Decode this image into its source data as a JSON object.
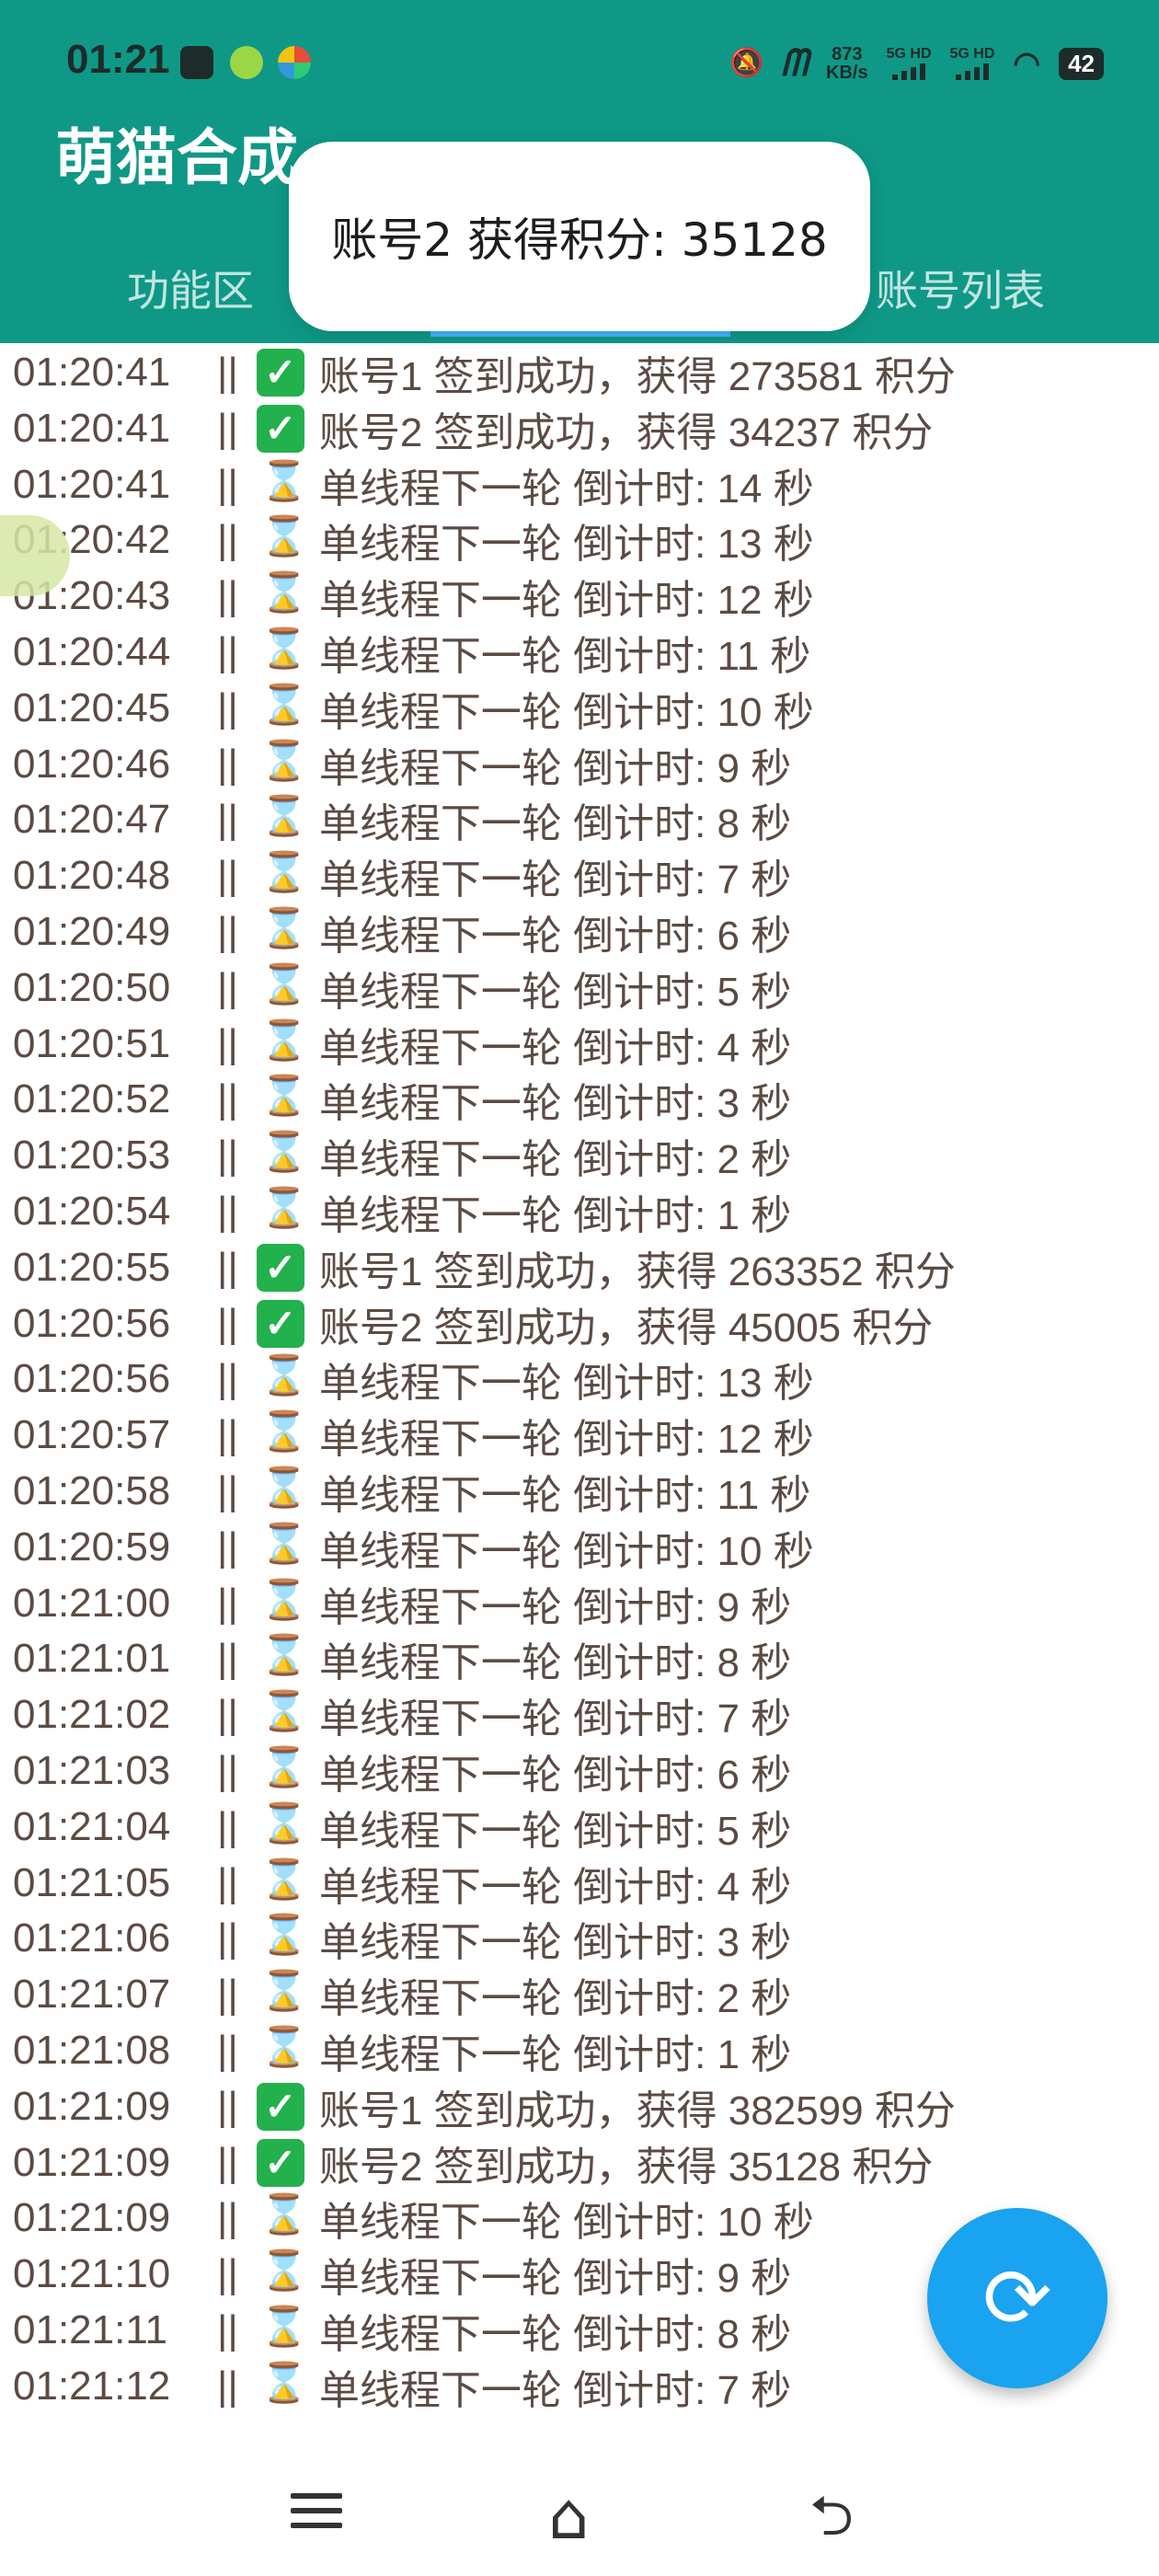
{
  "status_bar": {
    "time": "01:21",
    "speed_value": "873",
    "speed_unit": "KB/s",
    "sim1": "5G HD",
    "sim2": "5G HD",
    "battery": "42"
  },
  "header": {
    "app_title": "萌猫合成",
    "tab_function": "功能区",
    "tab_accounts": "账号列表"
  },
  "toast": {
    "text": "账号2 获得积分: 35128"
  },
  "log": {
    "separator": "||",
    "rows": [
      {
        "time": "01:20:41",
        "icon": "check",
        "text": "账号1 签到成功，获得 273581 积分"
      },
      {
        "time": "01:20:41",
        "icon": "check",
        "text": "账号2 签到成功，获得 34237 积分"
      },
      {
        "time": "01:20:41",
        "icon": "hourglass",
        "text": "单线程下一轮 倒计时: 14 秒"
      },
      {
        "time": "01:20:42",
        "icon": "hourglass",
        "text": "单线程下一轮 倒计时: 13 秒"
      },
      {
        "time": "01:20:43",
        "icon": "hourglass",
        "text": "单线程下一轮 倒计时: 12 秒"
      },
      {
        "time": "01:20:44",
        "icon": "hourglass",
        "text": "单线程下一轮 倒计时: 11 秒"
      },
      {
        "time": "01:20:45",
        "icon": "hourglass",
        "text": "单线程下一轮 倒计时: 10 秒"
      },
      {
        "time": "01:20:46",
        "icon": "hourglass",
        "text": "单线程下一轮 倒计时: 9 秒"
      },
      {
        "time": "01:20:47",
        "icon": "hourglass",
        "text": "单线程下一轮 倒计时: 8 秒"
      },
      {
        "time": "01:20:48",
        "icon": "hourglass",
        "text": "单线程下一轮 倒计时: 7 秒"
      },
      {
        "time": "01:20:49",
        "icon": "hourglass",
        "text": "单线程下一轮 倒计时: 6 秒"
      },
      {
        "time": "01:20:50",
        "icon": "hourglass",
        "text": "单线程下一轮 倒计时: 5 秒"
      },
      {
        "time": "01:20:51",
        "icon": "hourglass",
        "text": "单线程下一轮 倒计时: 4 秒"
      },
      {
        "time": "01:20:52",
        "icon": "hourglass",
        "text": "单线程下一轮 倒计时: 3 秒"
      },
      {
        "time": "01:20:53",
        "icon": "hourglass",
        "text": "单线程下一轮 倒计时: 2 秒"
      },
      {
        "time": "01:20:54",
        "icon": "hourglass",
        "text": "单线程下一轮 倒计时: 1 秒"
      },
      {
        "time": "01:20:55",
        "icon": "check",
        "text": "账号1 签到成功，获得 263352 积分"
      },
      {
        "time": "01:20:56",
        "icon": "check",
        "text": "账号2 签到成功，获得 45005 积分"
      },
      {
        "time": "01:20:56",
        "icon": "hourglass",
        "text": "单线程下一轮 倒计时: 13 秒"
      },
      {
        "time": "01:20:57",
        "icon": "hourglass",
        "text": "单线程下一轮 倒计时: 12 秒"
      },
      {
        "time": "01:20:58",
        "icon": "hourglass",
        "text": "单线程下一轮 倒计时: 11 秒"
      },
      {
        "time": "01:20:59",
        "icon": "hourglass",
        "text": "单线程下一轮 倒计时: 10 秒"
      },
      {
        "time": "01:21:00",
        "icon": "hourglass",
        "text": "单线程下一轮 倒计时: 9 秒"
      },
      {
        "time": "01:21:01",
        "icon": "hourglass",
        "text": "单线程下一轮 倒计时: 8 秒"
      },
      {
        "time": "01:21:02",
        "icon": "hourglass",
        "text": "单线程下一轮 倒计时: 7 秒"
      },
      {
        "time": "01:21:03",
        "icon": "hourglass",
        "text": "单线程下一轮 倒计时: 6 秒"
      },
      {
        "time": "01:21:04",
        "icon": "hourglass",
        "text": "单线程下一轮 倒计时: 5 秒"
      },
      {
        "time": "01:21:05",
        "icon": "hourglass",
        "text": "单线程下一轮 倒计时: 4 秒"
      },
      {
        "time": "01:21:06",
        "icon": "hourglass",
        "text": "单线程下一轮 倒计时: 3 秒"
      },
      {
        "time": "01:21:07",
        "icon": "hourglass",
        "text": "单线程下一轮 倒计时: 2 秒"
      },
      {
        "time": "01:21:08",
        "icon": "hourglass",
        "text": "单线程下一轮 倒计时: 1 秒"
      },
      {
        "time": "01:21:09",
        "icon": "check",
        "text": "账号1 签到成功，获得 382599 积分"
      },
      {
        "time": "01:21:09",
        "icon": "check",
        "text": "账号2 签到成功，获得 35128 积分"
      },
      {
        "time": "01:21:09",
        "icon": "hourglass",
        "text": "单线程下一轮 倒计时: 10 秒"
      },
      {
        "time": "01:21:10",
        "icon": "hourglass",
        "text": "单线程下一轮 倒计时: 9 秒"
      },
      {
        "time": "01:21:11",
        "icon": "hourglass",
        "text": "单线程下一轮 倒计时: 8 秒"
      },
      {
        "time": "01:21:12",
        "icon": "hourglass",
        "text": "单线程下一轮 倒计时: 7 秒"
      }
    ]
  },
  "fab": {
    "icon": "refresh-icon"
  },
  "colors": {
    "header": "#0f9886",
    "accent": "#1aa3f0",
    "log_text": "#5c4b43"
  }
}
